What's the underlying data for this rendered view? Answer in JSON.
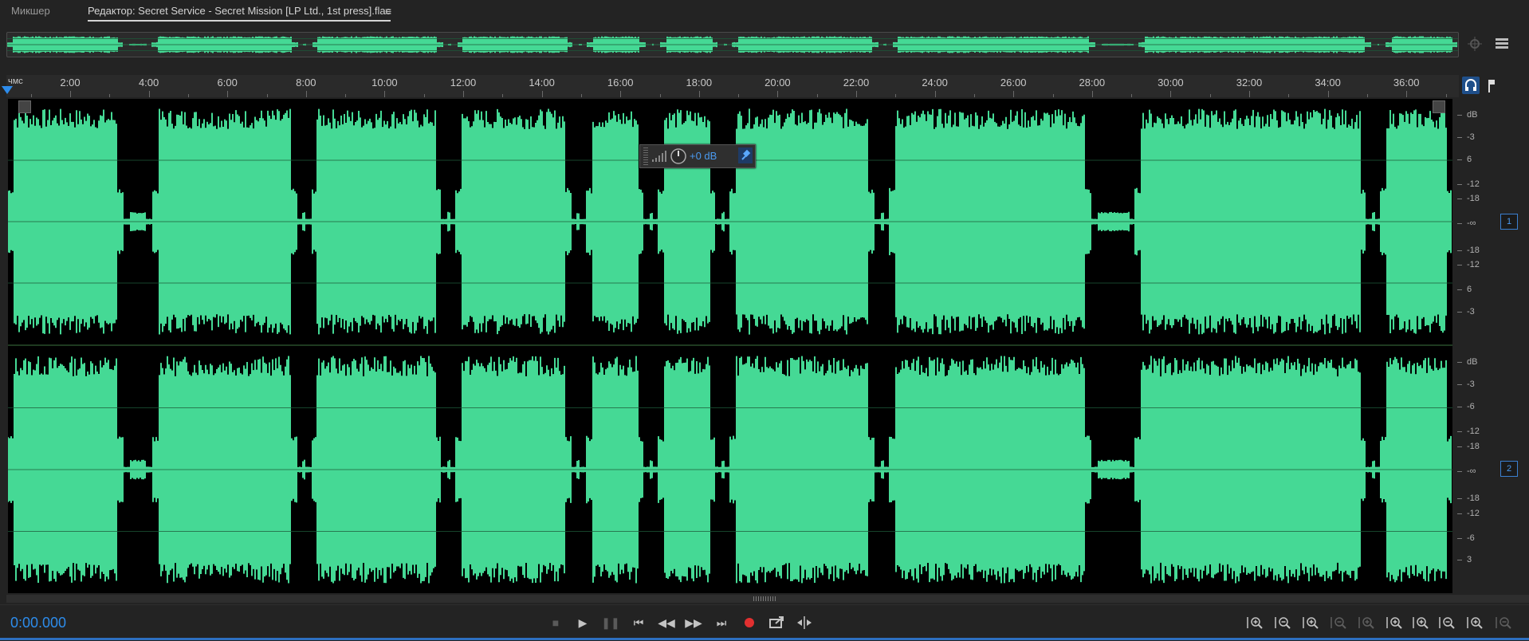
{
  "tabs": {
    "mixer": "Микшер",
    "editor": "Редактор: Secret Service - Secret Mission [LP Ltd., 1st press].flac",
    "menu_icon": "hamburger-menu-icon"
  },
  "colors": {
    "waveform": "#45d995",
    "accent": "#2d8ceb",
    "record": "#e23030",
    "background": "#232323"
  },
  "ruler": {
    "unit_label": "чмс",
    "labels": [
      "2:00",
      "4:00",
      "6:00",
      "8:00",
      "10:00",
      "12:00",
      "14:00",
      "16:00",
      "18:00",
      "20:00",
      "22:00",
      "24:00",
      "26:00",
      "28:00",
      "30:00",
      "32:00",
      "34:00",
      "36:00"
    ],
    "icons": [
      "snap-headphones-icon",
      "marker-flag-icon"
    ]
  },
  "channels": [
    {
      "id": "1",
      "db_labels": [
        "dB",
        "-3",
        "6",
        "-12",
        "-18",
        "-∞",
        "-18",
        "-12",
        "6",
        "-3"
      ]
    },
    {
      "id": "2",
      "db_labels": [
        "dB",
        "-3",
        "-6",
        "-12",
        "-18",
        "-∞",
        "-18",
        "-12",
        "-6",
        "3"
      ]
    }
  ],
  "hud": {
    "gain_label": "+0 dB",
    "knob_icon": "volume-knob-icon",
    "pin_icon": "pin-icon"
  },
  "transport": {
    "time": "0:00.000",
    "buttons": [
      "stop-icon",
      "play-icon",
      "pause-icon",
      "skip-to-start-icon",
      "rewind-icon",
      "fast-forward-icon",
      "skip-to-end-icon",
      "record-icon",
      "loop-playback-icon",
      "skip-selection-icon"
    ]
  },
  "zoom": {
    "buttons": [
      "zoom-in-amplitude-icon",
      "zoom-out-amplitude-icon",
      "zoom-in-time-icon",
      "zoom-out-full-icon",
      "zoom-selection-icon",
      "zoom-in-left-icon",
      "zoom-in-right-icon",
      "zoom-out-time-icon",
      "zoom-to-selection-icon",
      "zoom-out-all-icon"
    ]
  }
}
